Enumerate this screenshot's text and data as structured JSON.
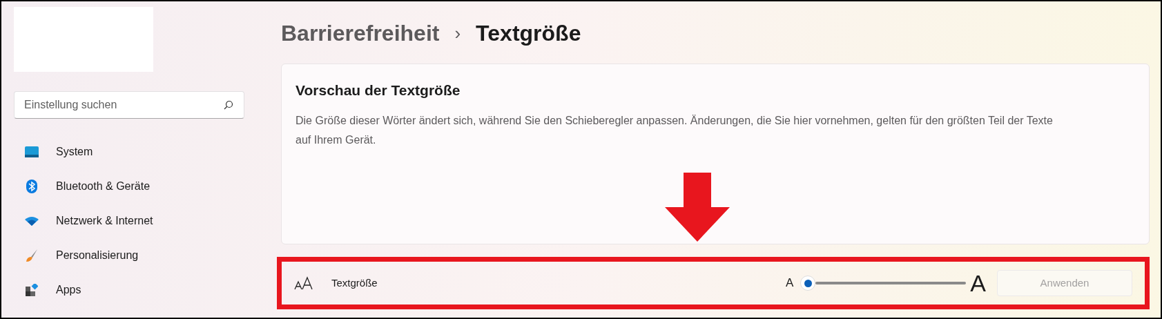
{
  "search": {
    "placeholder": "Einstellung suchen"
  },
  "nav": [
    {
      "label": "System",
      "kind": "system"
    },
    {
      "label": "Bluetooth & Geräte",
      "kind": "bluetooth"
    },
    {
      "label": "Netzwerk & Internet",
      "kind": "network"
    },
    {
      "label": "Personalisierung",
      "kind": "brush"
    },
    {
      "label": "Apps",
      "kind": "apps"
    }
  ],
  "breadcrumb": {
    "parent": "Barrierefreiheit",
    "separator": "›",
    "current": "Textgröße"
  },
  "preview": {
    "title": "Vorschau der Textgröße",
    "text": "Die Größe dieser Wörter ändert sich, während Sie den Schieberegler anpassen. Änderungen, die Sie hier vornehmen, gelten für den größten Teil der Texte auf Ihrem Gerät."
  },
  "setting": {
    "label": "Textgröße",
    "small_mark": "A",
    "large_mark": "A",
    "apply": {
      "label": "Anwenden",
      "disabled": true
    }
  }
}
